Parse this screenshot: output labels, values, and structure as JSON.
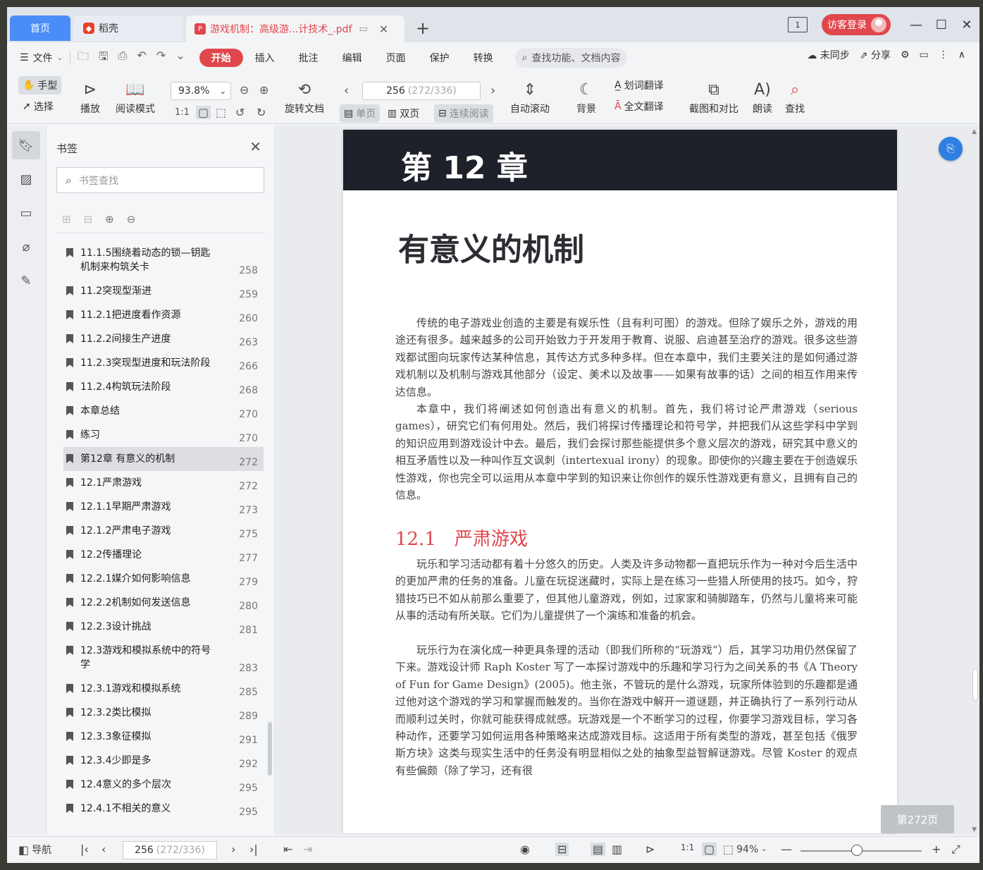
{
  "titlebar": {
    "tab_home": "首页",
    "tab_daoke": "稻壳",
    "tab_pdf": "游戏机制：高级游...计技术_.pdf",
    "login": "访客登录"
  },
  "menubar": {
    "file": "文件",
    "tabs": [
      "开始",
      "插入",
      "批注",
      "编辑",
      "页面",
      "保护",
      "转换"
    ],
    "search": "查找功能、文档内容",
    "sync": "未同步",
    "share": "分享"
  },
  "toolbar": {
    "hand": "手型",
    "select": "选择",
    "play": "播放",
    "read_mode": "阅读模式",
    "zoom": "93.8%",
    "rotate": "旋转文档",
    "page_current": "256",
    "page_total": "(272/336)",
    "single": "单页",
    "double": "双页",
    "continuous": "连续阅读",
    "auto_scroll": "自动滚动",
    "background": "背景",
    "word_translate": "划词翻译",
    "full_translate": "全文翻译",
    "screenshot": "截图和对比",
    "read_aloud": "朗读",
    "find": "查找"
  },
  "panel": {
    "title": "书签",
    "search_placeholder": "书签查找",
    "items": [
      {
        "title": "11.1.5围绕着动态的锁—钥匙机制来构筑关卡",
        "page": "258"
      },
      {
        "title": "11.2突现型渐进",
        "page": "259"
      },
      {
        "title": "11.2.1把进度看作资源",
        "page": "260"
      },
      {
        "title": "11.2.2间接生产进度",
        "page": "263"
      },
      {
        "title": "11.2.3突现型进度和玩法阶段",
        "page": "266"
      },
      {
        "title": "11.2.4构筑玩法阶段",
        "page": "268"
      },
      {
        "title": "本章总结",
        "page": "270"
      },
      {
        "title": "练习",
        "page": "270"
      },
      {
        "title": "第12章  有意义的机制",
        "page": "272"
      },
      {
        "title": "12.1严肃游戏",
        "page": "272"
      },
      {
        "title": "12.1.1早期严肃游戏",
        "page": "273"
      },
      {
        "title": "12.1.2严肃电子游戏",
        "page": "275"
      },
      {
        "title": "12.2传播理论",
        "page": "277"
      },
      {
        "title": "12.2.1媒介如何影响信息",
        "page": "279"
      },
      {
        "title": "12.2.2机制如何发送信息",
        "page": "280"
      },
      {
        "title": "12.2.3设计挑战",
        "page": "281"
      },
      {
        "title": "12.3游戏和模拟系统中的符号学",
        "page": "283"
      },
      {
        "title": "12.3.1游戏和模拟系统",
        "page": "285"
      },
      {
        "title": "12.3.2类比模拟",
        "page": "289"
      },
      {
        "title": "12.3.3象征模拟",
        "page": "291"
      },
      {
        "title": "12.3.4少即是多",
        "page": "292"
      },
      {
        "title": "12.4意义的多个层次",
        "page": "295"
      },
      {
        "title": "12.4.1不相关的意义",
        "page": "295"
      }
    ]
  },
  "document": {
    "chapter_banner": "第 12 章",
    "chapter_title": "有意义的机制",
    "para1": "传统的电子游戏业创造的主要是有娱乐性（且有利可图）的游戏。但除了娱乐之外，游戏的用途还有很多。越来越多的公司开始致力于开发用于教育、说服、启迪甚至治疗的游戏。很多这些游戏都试图向玩家传达某种信息，其传达方式多种多样。但在本章中，我们主要关注的是如何通过游戏机制以及机制与游戏其他部分（设定、美术以及故事——如果有故事的话）之间的相互作用来传达信息。",
    "para2": "本章中，我们将阐述如何创造出有意义的机制。首先，我们将讨论严肃游戏（serious games），研究它们有何用处。然后，我们将探讨传播理论和符号学，并把我们从这些学科中学到的知识应用到游戏设计中去。最后，我们会探讨那些能提供多个意义层次的游戏，研究其中意义的相互矛盾性以及一种叫作互文讽刺（intertexual irony）的现象。即使你的兴趣主要在于创造娱乐性游戏，你也完全可以运用从本章中学到的知识来让你创作的娱乐性游戏更有意义，且拥有自己的信息。",
    "section_heading": "12.1　严肃游戏",
    "para3": "玩乐和学习活动都有着十分悠久的历史。人类及许多动物都一直把玩乐作为一种对今后生活中的更加严肃的任务的准备。儿童在玩捉迷藏时，实际上是在练习一些猎人所使用的技巧。如今，狩猎技巧已不如从前那么重要了，但其他儿童游戏，例如，过家家和骑脚踏车，仍然与儿童将来可能从事的活动有所关联。它们为儿童提供了一个演练和准备的机会。",
    "para4": "玩乐行为在演化成一种更具条理的活动（即我们所称的“玩游戏”）后，其学习功用仍然保留了下来。游戏设计师 Raph Koster 写了一本探讨游戏中的乐趣和学习行为之间关系的书《A Theory of Fun for Game Design》(2005)。他主张，不管玩的是什么游戏，玩家所体验到的乐趣都是通过他对这个游戏的学习和掌握而触发的。当你在游戏中解开一道谜题，并正确执行了一系列行动从而顺利过关时，你就可能获得成就感。玩游戏是一个不断学习的过程，你要学习游戏目标，学习各种动作，还要学习如何运用各种策略来达成游戏目标。这适用于所有类型的游戏，甚至包括《俄罗斯方块》这类与现实生活中的任务没有明显相似之处的抽象型益智解谜游戏。尽管 Koster 的观点有些偏颇（除了学习，还有很",
    "page_badge": "第272页"
  },
  "statusbar": {
    "nav": "导航",
    "page_current": "256",
    "page_total": "(272/336)",
    "zoom": "94%"
  },
  "colors": {
    "accent": "#e0474c",
    "home_tab": "#4a8df8",
    "banner": "#1e2129"
  }
}
